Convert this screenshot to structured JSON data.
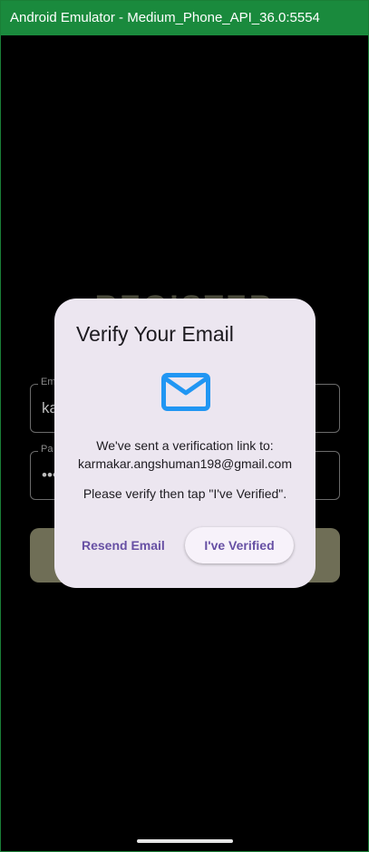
{
  "window": {
    "title": "Android Emulator - Medium_Phone_API_36.0:5554"
  },
  "background_form": {
    "title": "REGISTER",
    "email_label": "Em",
    "email_value": "ka",
    "password_label": "Pa",
    "password_value": "•••"
  },
  "dialog": {
    "title": "Verify Your Email",
    "icon": "mail-icon",
    "message_line1": "We've sent a verification link to:",
    "email": "karmakar.angshuman198@gmail.com",
    "message_line2": "Please verify then tap \"I've Verified\".",
    "resend_label": "Resend Email",
    "verified_label": "I've Verified"
  },
  "colors": {
    "titlebar": "#1a8a3d",
    "dialog_bg": "#ece6f0",
    "accent": "#6750a4",
    "icon": "#2196f3"
  }
}
